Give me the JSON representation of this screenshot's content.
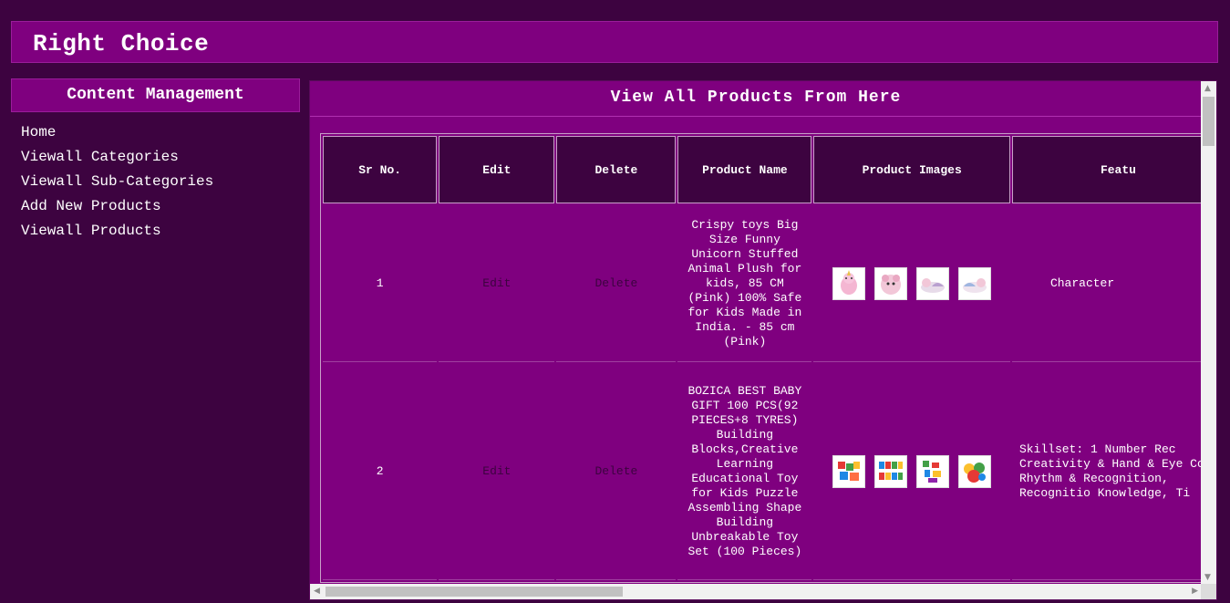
{
  "app": {
    "title": "Right Choice"
  },
  "sidebar": {
    "heading": "Content Management",
    "items": [
      {
        "label": "Home"
      },
      {
        "label": "Viewall Categories"
      },
      {
        "label": "Viewall Sub-Categories"
      },
      {
        "label": "Add New Products"
      },
      {
        "label": "Viewall Products"
      }
    ]
  },
  "main": {
    "heading": "View All Products From Here",
    "columns": [
      "Sr No.",
      "Edit",
      "Delete",
      "Product Name",
      "Product Images",
      "Featu"
    ],
    "rows": [
      {
        "sr": "1",
        "edit": "Edit",
        "delete": "Delete",
        "name": "Crispy toys Big Size Funny Unicorn Stuffed Animal Plush for kids, 85 CM (Pink) 100% Safe for Kids Made in India. - 85 cm (Pink)",
        "images": [
          "unicorn-plush-1",
          "unicorn-plush-2",
          "unicorn-plush-3",
          "unicorn-plush-4"
        ],
        "features": "Character"
      },
      {
        "sr": "2",
        "edit": "Edit",
        "delete": "Delete",
        "name": "BOZICA BEST BABY GIFT 100 PCS(92 PIECES+8 TYRES) Building Blocks,Creative Learning Educational Toy for Kids Puzzle Assembling Shape Building Unbreakable Toy Set (100 Pieces)",
        "images": [
          "blocks-1",
          "blocks-2",
          "blocks-3",
          "blocks-4"
        ],
        "features": "Skillset: 1 Number Rec Creativity & Hand & Eye Co Rhythm & Recognition, Recognitio Knowledge, Ti"
      }
    ]
  },
  "colors": {
    "background": "#3d0340",
    "accent": "#7f007f",
    "link": "#3d0340"
  }
}
